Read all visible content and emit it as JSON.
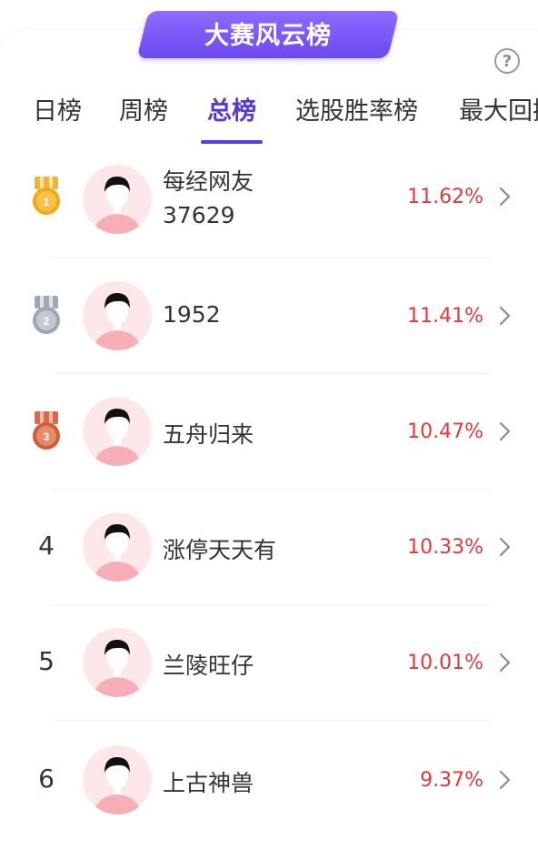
{
  "banner": {
    "title": "大赛风云榜"
  },
  "help": {
    "glyph": "?"
  },
  "tabs": [
    {
      "label": "日榜",
      "active": false
    },
    {
      "label": "周榜",
      "active": false
    },
    {
      "label": "总榜",
      "active": true
    },
    {
      "label": "选股胜率榜",
      "active": false
    },
    {
      "label": "最大回撤榜",
      "active": false
    }
  ],
  "ranking": [
    {
      "rank": "1",
      "medal": "gold",
      "name": "每经网友",
      "name_line2": "37629",
      "value": "11.62%"
    },
    {
      "rank": "2",
      "medal": "silver",
      "name": "1952",
      "value": "11.41%"
    },
    {
      "rank": "3",
      "medal": "bronze",
      "name": "五舟归来",
      "value": "10.47%"
    },
    {
      "rank": "4",
      "medal": "",
      "name": "涨停天天有",
      "value": "10.33%"
    },
    {
      "rank": "5",
      "medal": "",
      "name": "兰陵旺仔",
      "value": "10.01%"
    },
    {
      "rank": "6",
      "medal": "",
      "name": "上古神兽",
      "value": "9.37%"
    }
  ],
  "colors": {
    "accent": "#5638d8",
    "banner": "#7a58f5",
    "positive": "#e0393b",
    "gold": "#f2a81d",
    "silver": "#a9b0ba",
    "bronze": "#d56a4a"
  }
}
